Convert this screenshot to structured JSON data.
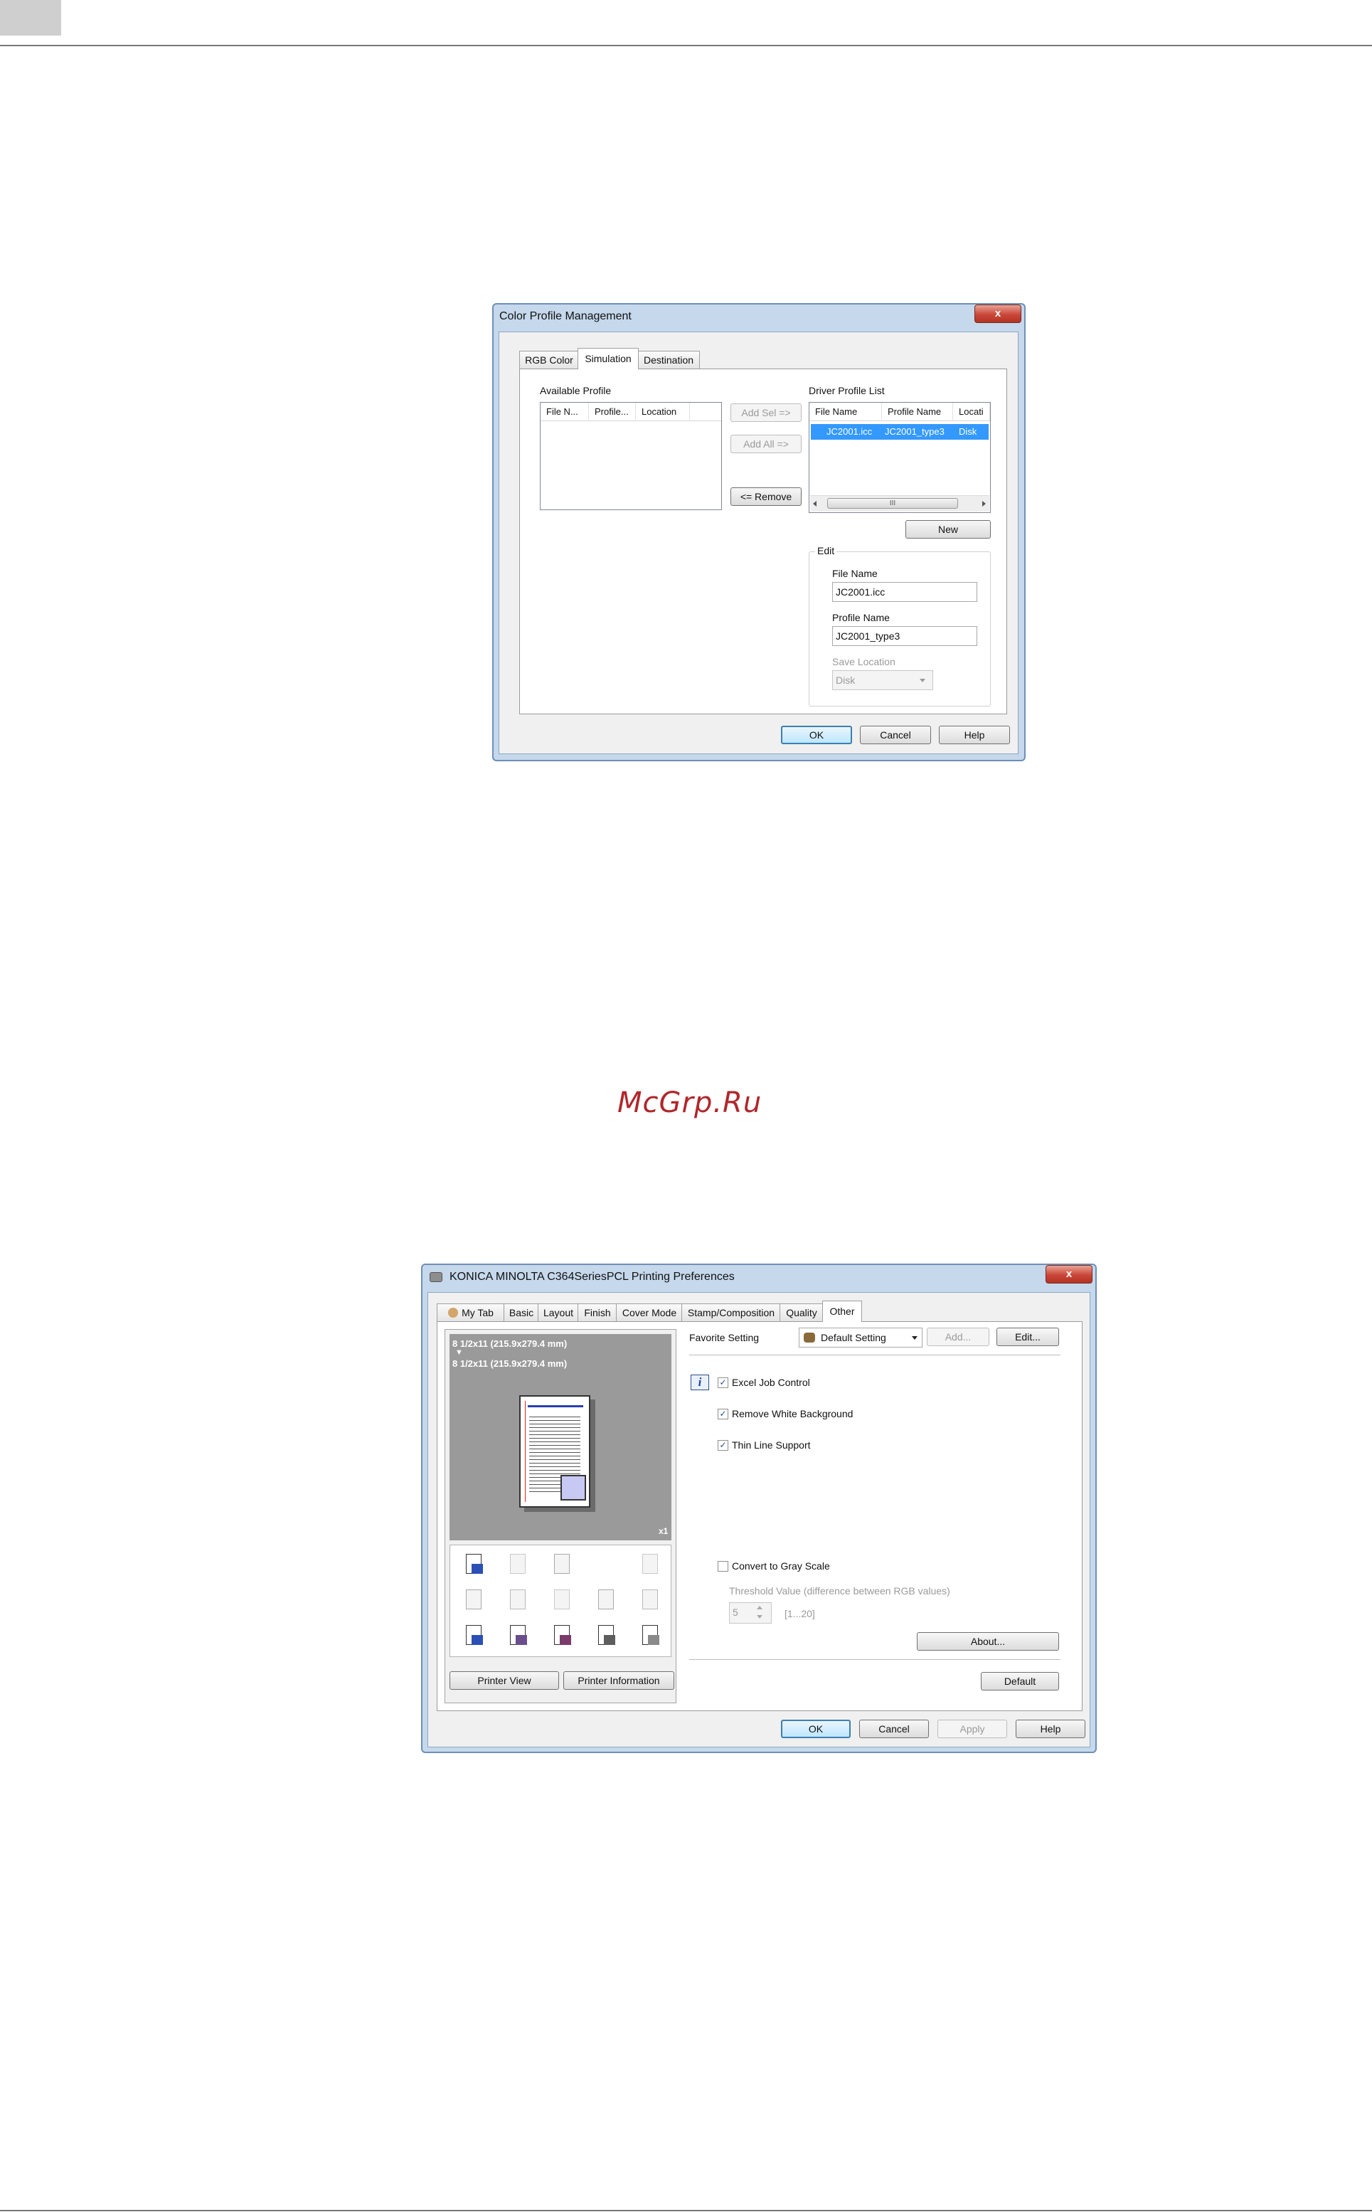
{
  "colors": {
    "window_frame": "#c5d8ec",
    "selection": "#3399ff",
    "preview_bg": "#9a9a9a",
    "watermark": "#b0272b",
    "close_button": "#c9473a"
  },
  "watermark": "McGrp.Ru",
  "dialog1": {
    "title": "Color Profile Management",
    "close_glyph": "x",
    "tabs": [
      {
        "label": "RGB Color",
        "active": false
      },
      {
        "label": "Simulation",
        "active": true
      },
      {
        "label": "Destination",
        "active": false
      }
    ],
    "available_profile": {
      "label": "Available Profile",
      "columns": [
        "File N...",
        "Profile...",
        "Location"
      ]
    },
    "buttons": {
      "add_sel": "Add Sel =>",
      "add_all": "Add All =>",
      "remove": "<= Remove",
      "new": "New",
      "ok": "OK",
      "cancel": "Cancel",
      "help": "Help"
    },
    "driver_profile": {
      "label": "Driver Profile List",
      "columns": [
        "File Name",
        "Profile Name",
        "Locati"
      ],
      "rows": [
        {
          "file_name": "JC2001.icc",
          "profile_name": "JC2001_type3",
          "location": "Disk",
          "selected": true
        }
      ],
      "scroll_thumb": "III"
    },
    "edit": {
      "group_label": "Edit",
      "file_name_label": "File Name",
      "file_name_value": "JC2001.icc",
      "profile_name_label": "Profile Name",
      "profile_name_value": "JC2001_type3",
      "save_location_label": "Save Location",
      "save_location_value": "Disk"
    }
  },
  "dialog2": {
    "title": "KONICA MINOLTA C364SeriesPCL Printing Preferences",
    "close_glyph": "x",
    "tabs": [
      {
        "label": "My Tab",
        "active": false
      },
      {
        "label": "Basic",
        "active": false
      },
      {
        "label": "Layout",
        "active": false
      },
      {
        "label": "Finish",
        "active": false
      },
      {
        "label": "Cover Mode",
        "active": false
      },
      {
        "label": "Stamp/Composition",
        "active": false
      },
      {
        "label": "Quality",
        "active": false
      },
      {
        "label": "Other",
        "active": true
      }
    ],
    "preview": {
      "original_size": "8 1/2x11 (215.9x279.4 mm)",
      "arrow": "▼",
      "output_size": "8 1/2x11 (215.9x279.4 mm)",
      "copies": "x1"
    },
    "function_icons": [
      "paper-output-icon",
      "blank-icon",
      "pages-icon",
      "spacer",
      "rotate-icon",
      "stack-icon",
      "multi-page-icon",
      "text-page-icon",
      "single-page-icon",
      "watermark-icon",
      "color-icon",
      "user-icon",
      "account-icon",
      "document-icon",
      "tray-icon"
    ],
    "buttons": {
      "printer_view": "Printer View",
      "printer_information": "Printer Information",
      "add": "Add...",
      "edit": "Edit...",
      "about": "About...",
      "default": "Default",
      "ok": "OK",
      "cancel": "Cancel",
      "apply": "Apply",
      "help": "Help"
    },
    "favorite_setting": {
      "label": "Favorite Setting",
      "value": "Default Setting"
    },
    "info_glyph": "i",
    "options": [
      {
        "label": "Excel Job Control",
        "checked": true
      },
      {
        "label": "Remove White Background",
        "checked": true
      },
      {
        "label": "Thin Line Support",
        "checked": true
      }
    ],
    "gray_scale": {
      "label": "Convert to Gray Scale",
      "checked": false,
      "threshold_label": "Threshold Value (difference between RGB values)",
      "threshold_value": "5",
      "threshold_range": "[1...20]"
    },
    "check_glyph": "✓"
  }
}
